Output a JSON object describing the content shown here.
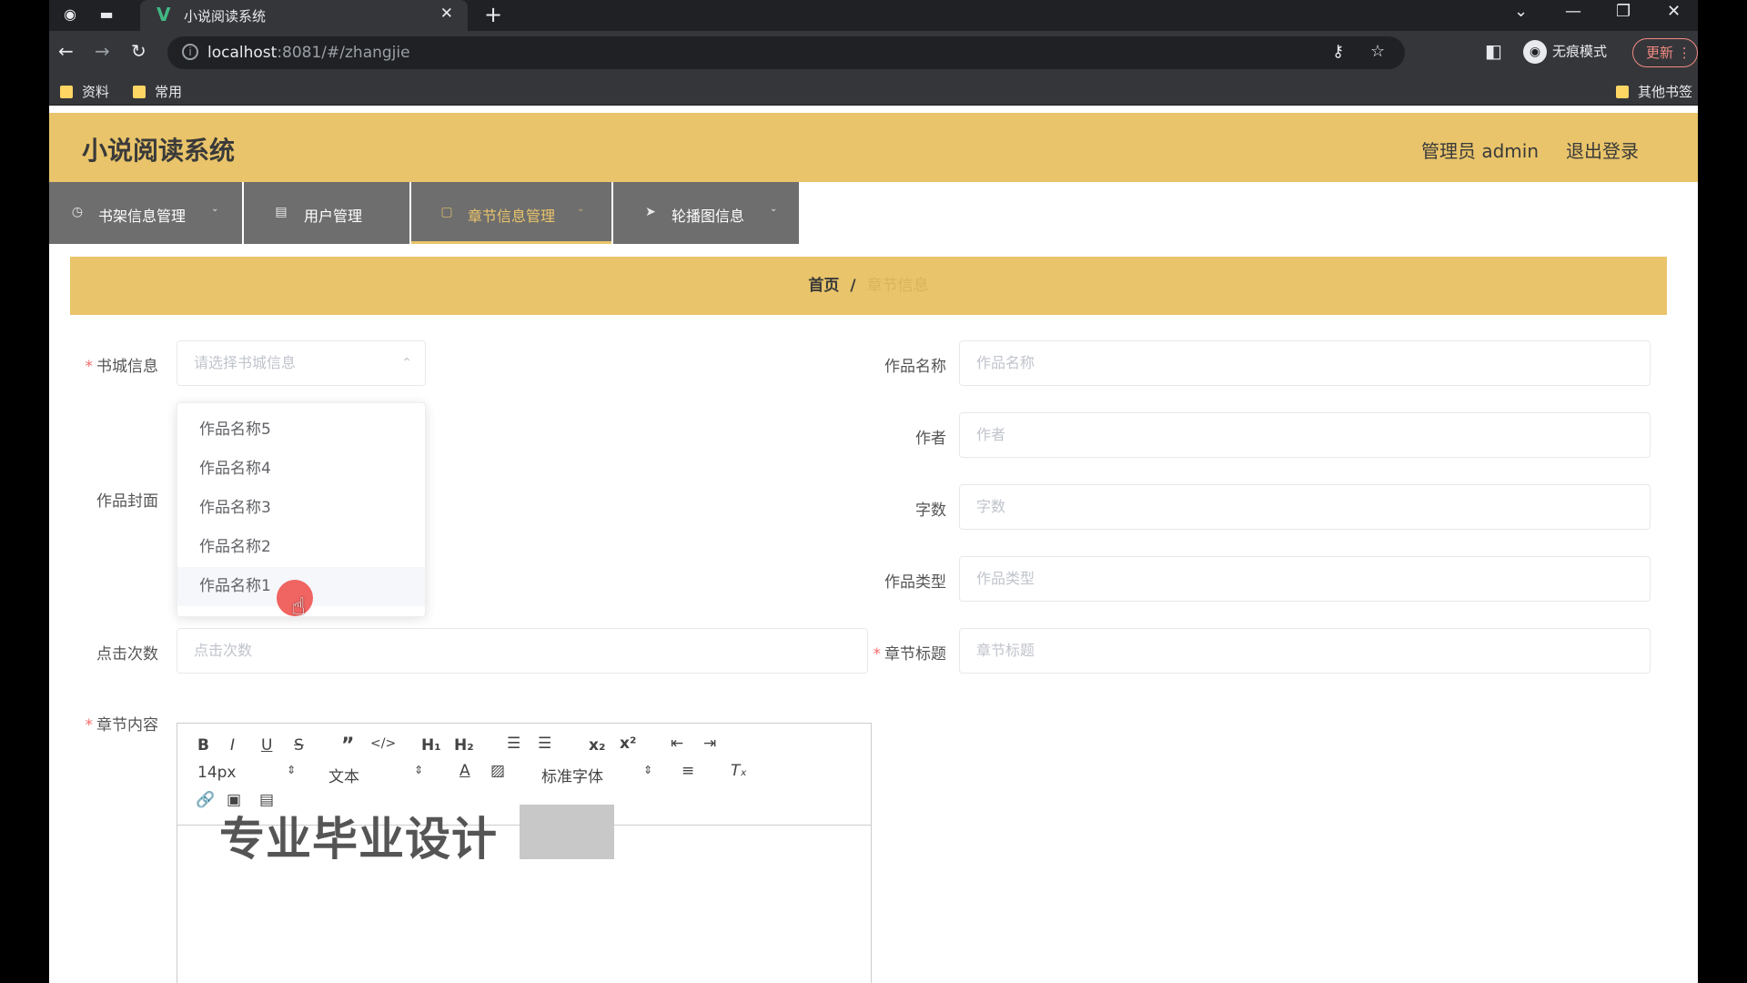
{
  "browser": {
    "tab_title": "小说阅读系统",
    "url_host": "localhost",
    "url_rest": ":8081/#/zhangjie",
    "incognito_label": "无痕模式",
    "update_label": "更新",
    "bookmarks": [
      "资料",
      "常用"
    ],
    "other_bookmarks": "其他书签"
  },
  "header": {
    "brand": "小说阅读系统",
    "user": "管理员 admin",
    "logout": "退出登录"
  },
  "menu": {
    "items": [
      {
        "label": "书架信息管理",
        "icon": "clock-icon"
      },
      {
        "label": "用户管理",
        "icon": "chat-icon"
      },
      {
        "label": "章节信息管理",
        "icon": "document-icon"
      },
      {
        "label": "轮播图信息",
        "icon": "send-icon"
      }
    ],
    "active_index": 2
  },
  "breadcrumb": {
    "home": "首页",
    "separator": "/",
    "current": "章节信息"
  },
  "form": {
    "shucheng_label": "书城信息",
    "shucheng_placeholder": "请选择书城信息",
    "cover_label": "作品封面",
    "clicks_label": "点击次数",
    "clicks_placeholder": "点击次数",
    "content_label": "章节内容",
    "name_label": "作品名称",
    "name_placeholder": "作品名称",
    "author_label": "作者",
    "author_placeholder": "作者",
    "words_label": "字数",
    "words_placeholder": "字数",
    "type_label": "作品类型",
    "type_placeholder": "作品类型",
    "chapter_title_label": "章节标题",
    "chapter_title_placeholder": "章节标题"
  },
  "dropdown": {
    "options": [
      "作品名称5",
      "作品名称4",
      "作品名称3",
      "作品名称2",
      "作品名称1"
    ],
    "hover_index": 4
  },
  "editor": {
    "font_size": "14px",
    "paragraph": "文本",
    "font_family": "标准字体",
    "watermark": "专业毕业设计"
  }
}
